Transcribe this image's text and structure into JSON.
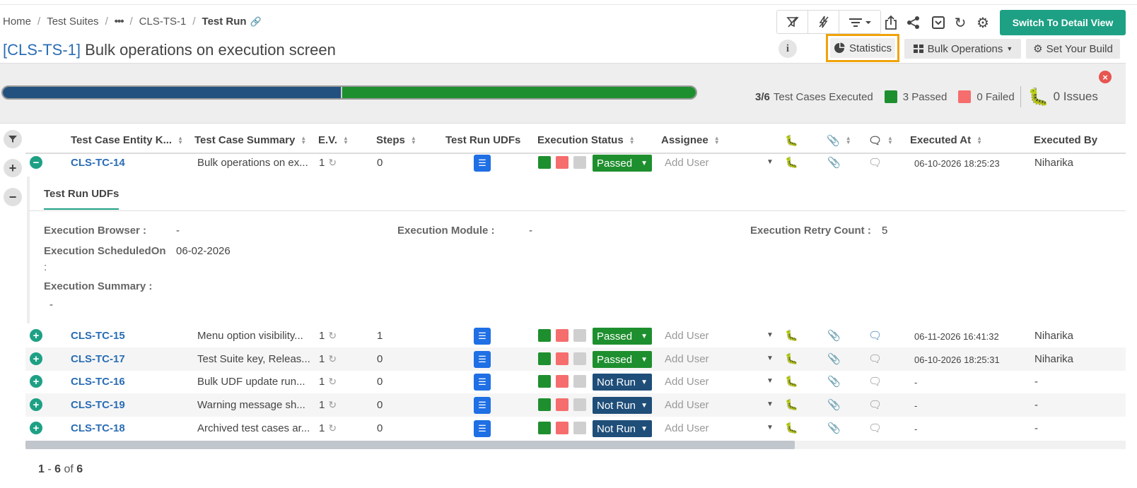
{
  "breadcrumb": {
    "home": "Home",
    "suites": "Test Suites",
    "more": "•••",
    "suite_key": "CLS-TS-1",
    "current": "Test Run"
  },
  "title": {
    "key": "[CLS-TS-1]",
    "name": "Bulk operations on execution screen"
  },
  "toolbar": {
    "switch_label": "Switch To Detail View",
    "statistics": "Statistics",
    "bulk": "Bulk Operations",
    "build": "Set Your Build",
    "info": "i"
  },
  "progress": {
    "executed_count": "3/6",
    "executed_label": "Test Cases Executed",
    "passed": "3 Passed",
    "failed": "0 Failed",
    "issues": "0 Issues",
    "pass_fraction": 0.5,
    "pass_color": "#1e8f2e",
    "fail_color": "#f56d6d"
  },
  "columns": {
    "key": "Test Case Entity K...",
    "summary": "Test Case Summary",
    "ev": "E.V.",
    "steps": "Steps",
    "udfs": "Test Run UDFs",
    "status": "Execution Status",
    "assignee": "Assignee",
    "executed_at": "Executed At",
    "executed_by": "Executed By"
  },
  "rows": [
    {
      "key": "CLS-TC-14",
      "summary": "Bulk operations on ex...",
      "ev": "1",
      "steps": "0",
      "status": "Passed",
      "assignee": "Add User",
      "executed_at": "06-10-2026 18:25:23",
      "executed_by": "Niharika"
    },
    {
      "key": "CLS-TC-15",
      "summary": "Menu option visibility...",
      "ev": "1",
      "steps": "1",
      "status": "Passed",
      "assignee": "Add User",
      "executed_at": "06-11-2026 16:41:32",
      "executed_by": "Niharika"
    },
    {
      "key": "CLS-TC-17",
      "summary": "Test Suite key, Releas...",
      "ev": "1",
      "steps": "0",
      "status": "Passed",
      "assignee": "Add User",
      "executed_at": "06-10-2026 18:25:31",
      "executed_by": "Niharika"
    },
    {
      "key": "CLS-TC-16",
      "summary": "Bulk UDF update run...",
      "ev": "1",
      "steps": "0",
      "status": "Not Run",
      "assignee": "Add User",
      "executed_at": "-",
      "executed_by": "-"
    },
    {
      "key": "CLS-TC-19",
      "summary": "Warning message sh...",
      "ev": "1",
      "steps": "0",
      "status": "Not Run",
      "assignee": "Add User",
      "executed_at": "-",
      "executed_by": "-"
    },
    {
      "key": "CLS-TC-18",
      "summary": "Archived test cases ar...",
      "ev": "1",
      "steps": "0",
      "status": "Not Run",
      "assignee": "Add User",
      "executed_at": "-",
      "executed_by": "-"
    }
  ],
  "udf_panel": {
    "tab": "Test Run UDFs",
    "browser_label": "Execution Browser :",
    "browser_value": "-",
    "module_label": "Execution Module :",
    "module_value": "-",
    "retry_label": "Execution Retry Count :",
    "retry_value": "5",
    "scheduled_label": "Execution ScheduledOn",
    "scheduled_colon": ":",
    "scheduled_value": "06-02-2026",
    "summary_label": "Execution Summary :",
    "summary_value": "-"
  },
  "pager": {
    "from": "1",
    "dash": "-",
    "to": "6",
    "of": "of",
    "total": "6"
  },
  "colors": {
    "accent": "#1ea085",
    "passed": "#1e8f2e",
    "not_run": "#1f4e79",
    "link": "#2a6db5"
  }
}
